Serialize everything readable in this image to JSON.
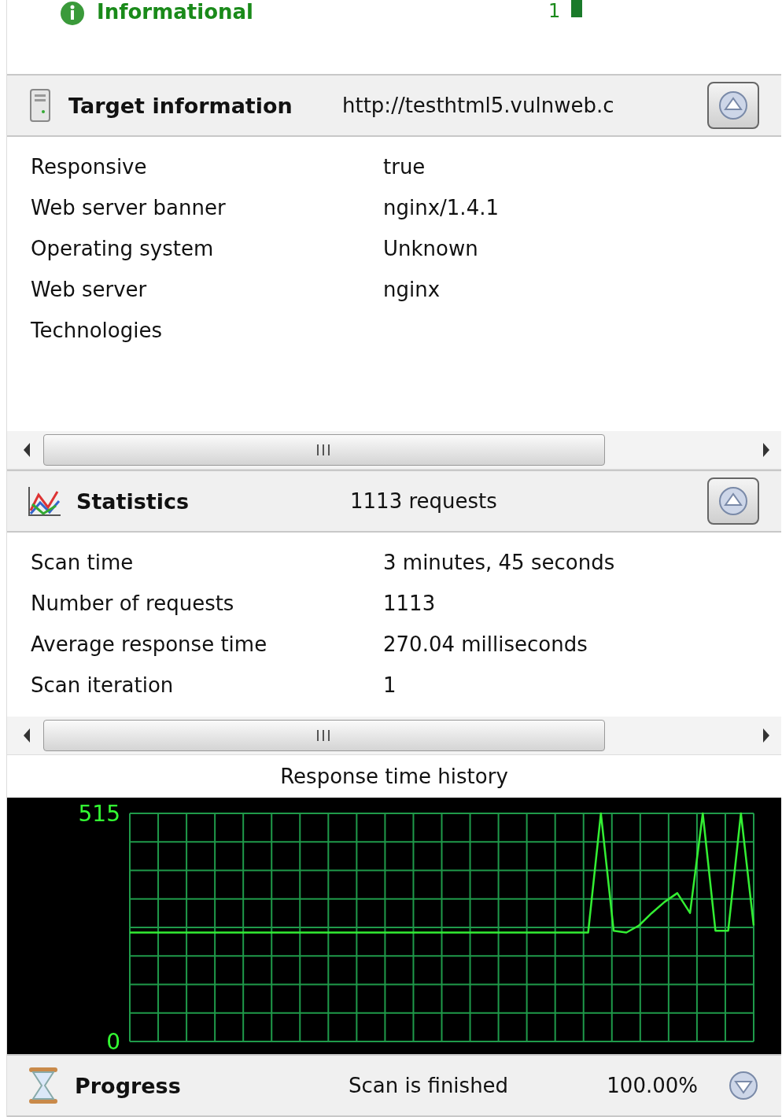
{
  "top_row": {
    "label": "Informational",
    "count": "1"
  },
  "sections": [
    {
      "kind": "target",
      "title": "Target information",
      "summary": "http://testhtml5.vulnweb.c",
      "expanded": true,
      "rows": [
        {
          "key": "Responsive",
          "value": "true"
        },
        {
          "key": "Web server banner",
          "value": "nginx/1.4.1"
        },
        {
          "key": "Operating system",
          "value": "Unknown"
        },
        {
          "key": "Web server",
          "value": "nginx"
        },
        {
          "key": "Technologies"
        }
      ]
    },
    {
      "kind": "statistics",
      "title": "Statistics",
      "summary": "1113 requests",
      "expanded": true,
      "rows": [
        {
          "key": "Scan time",
          "value": "3 minutes, 45 seconds"
        },
        {
          "key": "Number of requests",
          "value": "1113"
        },
        {
          "key": "Average response time",
          "value": "270.04 milliseconds"
        },
        {
          "key": "Scan iteration",
          "value": "1"
        }
      ],
      "chart": {
        "title": "Response time history",
        "chart_data": {
          "type": "line",
          "ylim": [
            0,
            515
          ],
          "yticks": [
            0,
            515
          ],
          "grid": true,
          "series": [
            {
              "color": "#33ee33",
              "values": [
                246,
                246,
                246,
                246,
                246,
                246,
                246,
                246,
                246,
                246,
                246,
                246,
                246,
                246,
                246,
                246,
                246,
                246,
                246,
                246,
                246,
                246,
                246,
                246,
                246,
                246,
                246,
                246,
                246,
                246,
                246,
                246,
                246,
                246,
                246,
                246,
                246,
                515,
                250,
                246,
                262,
                290,
                315,
                335,
                290,
                515,
                250,
                250,
                515,
                262
              ]
            }
          ]
        }
      }
    },
    {
      "kind": "progress",
      "title": "Progress",
      "summary": "Scan is finished",
      "percent": "100.00%",
      "expanded": false
    }
  ]
}
